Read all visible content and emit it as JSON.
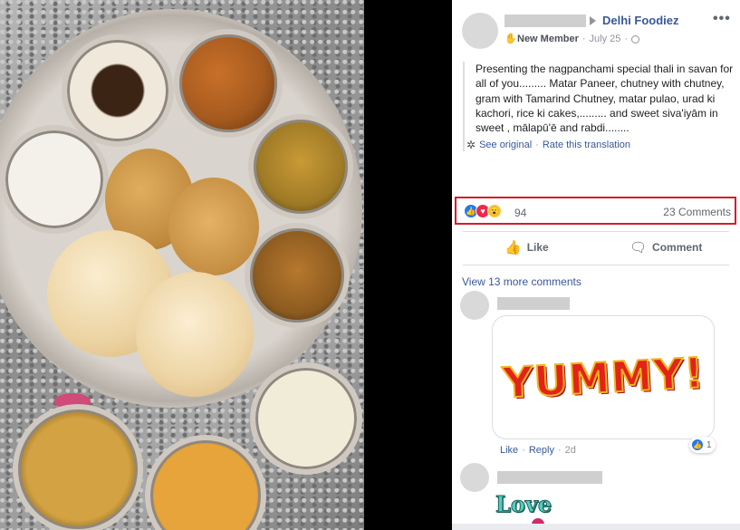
{
  "post": {
    "group_name": "Delhi Foodiez",
    "member_badge": "New Member",
    "date": "July 25",
    "text": "Presenting the nagpanchami special thali in savan for all of you......... Matar Paneer, chutney with chutney, gram with Tamarind Chutney, matar pulao, urad ki kachori, rice ki cakes,......... and sweet siva'iyām in sweet , mālapū'ē and rabdi........",
    "see_original": "See original",
    "rate_translation": "Rate this translation",
    "more_icon": "more-dots-icon"
  },
  "reactions": {
    "count": "94",
    "types": [
      "like",
      "love",
      "wow"
    ],
    "comments_count": "23 Comments",
    "highlight_color": "#d21f2a"
  },
  "actions": {
    "like_label": "Like",
    "comment_label": "Comment"
  },
  "comments": {
    "view_more": "View 13 more comments",
    "first": {
      "sticker_text": "YUMMY!",
      "like_link": "Like",
      "reply_link": "Reply",
      "time": "2d",
      "reaction_count": "1"
    },
    "second": {
      "sticker_text": "Love"
    }
  },
  "colors": {
    "link": "#385898",
    "meta": "#90949c",
    "like_blue": "#2078f4"
  }
}
